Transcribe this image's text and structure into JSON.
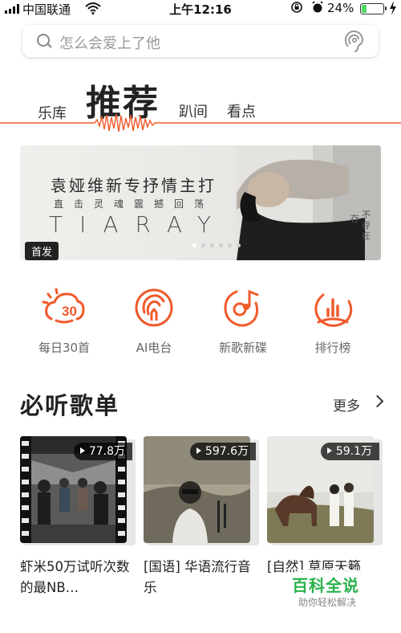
{
  "status_bar": {
    "carrier": "中国联通",
    "time": "上午12:16",
    "battery_percent": "24%",
    "battery_level": 0.24,
    "battery_color": "#4cd964"
  },
  "search": {
    "placeholder": "怎么会爱上了他",
    "icons": [
      "search-icon",
      "voice-icon"
    ]
  },
  "tabs": {
    "library": "乐库",
    "recommend": "推荐",
    "walk": "趴间",
    "watch": "看点"
  },
  "banner": {
    "title": "袁娅维新专抒情主打",
    "subtitle": "直击灵魂震撼回荡",
    "title_en": "TIARAY",
    "vertical_text_1": "存",
    "vertical_text_2": "不存在",
    "badge": "首发",
    "page_count": 6,
    "current_page": 1
  },
  "quick_entries": [
    {
      "label": "每日30首",
      "icon": "calendar-sun-icon"
    },
    {
      "label": "AI电台",
      "icon": "radio-icon"
    },
    {
      "label": "新歌新碟",
      "icon": "disc-note-icon"
    },
    {
      "label": "排行榜",
      "icon": "chart-icon"
    }
  ],
  "section": {
    "title": "必听歌单",
    "more": "更多"
  },
  "playlists": [
    {
      "play_count": "77.8万",
      "title": "虾米50万试听次数的最NB…"
    },
    {
      "play_count": "597.6万",
      "title": "[国语] 华语流行音乐"
    },
    {
      "play_count": "59.1万",
      "title": "[自然] 草原天籁"
    }
  ],
  "watermark": {
    "main": "百科全说",
    "sub": "助你轻松解决"
  },
  "colors": {
    "accent": "#f15a2b",
    "text_primary": "#222222",
    "text_secondary": "#666666"
  }
}
